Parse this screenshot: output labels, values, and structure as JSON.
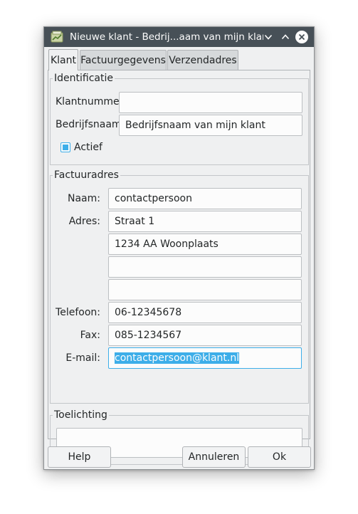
{
  "window": {
    "title": "Nieuwe klant - Bedrij...aam van mijn klant ()",
    "icon": "app-icon"
  },
  "tabs": [
    {
      "label": "Klant",
      "active": true
    },
    {
      "label": "Factuurgegevens",
      "active": false
    },
    {
      "label": "Verzendadres",
      "active": false
    }
  ],
  "identificatie": {
    "title": "Identificatie",
    "klantnummer_label": "Klantnummer:",
    "klantnummer_value": "",
    "bedrijfsnaam_label": "Bedrijfsnaam:",
    "bedrijfsnaam_value": "Bedrijfsnaam van mijn klant",
    "actief_label": "Actief",
    "actief_checked": true
  },
  "factuuradres": {
    "title": "Factuuradres",
    "naam_label": "Naam:",
    "naam_value": "contactpersoon",
    "adres_label": "Adres:",
    "adres_lines": [
      "Straat 1",
      "1234 AA Woonplaats",
      "",
      ""
    ],
    "telefoon_label": "Telefoon:",
    "telefoon_value": "06-12345678",
    "fax_label": "Fax:",
    "fax_value": "085-1234567",
    "email_label": "E-mail:",
    "email_value": "contactpersoon@klant.nl"
  },
  "toelichting": {
    "title": "Toelichting",
    "value": ""
  },
  "buttons": {
    "help": "Help",
    "annuleren": "Annuleren",
    "ok": "Ok"
  },
  "colors": {
    "titlebar": "#475057",
    "accent": "#3daee9",
    "window_bg": "#eff0f1"
  }
}
